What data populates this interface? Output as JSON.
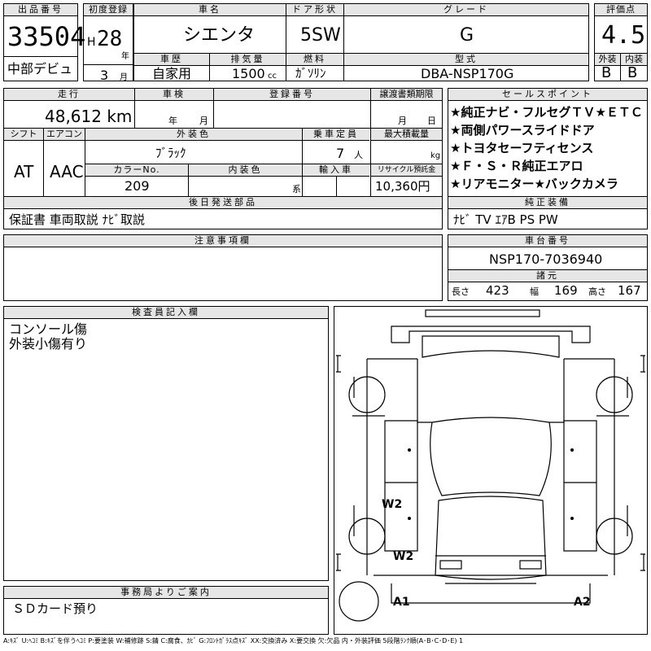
{
  "header": {
    "lot_label": "出品番号",
    "lot_no": "33504",
    "debut": "中部デビュ",
    "first_reg_label": "初度登録",
    "era": "H",
    "year": "28",
    "year_unit": "年",
    "month": "3",
    "month_unit": "月",
    "car_name_label": "車名",
    "car_name": "シエンタ",
    "door_label": "ドア形状",
    "door": "5SW",
    "grade_label": "グレード",
    "grade": "G",
    "score_label": "評価点",
    "score": "4.5",
    "history_label": "車歴",
    "history": "自家用",
    "displacement_label": "排気量",
    "displacement": "1500",
    "cc": "cc",
    "fuel_label": "燃料",
    "fuel": "ｶﾞｿﾘﾝ",
    "model_label": "型式",
    "model": "DBA-NSP170G",
    "ext_label": "外装",
    "ext_grade": "B",
    "int_label": "内装",
    "int_grade": "B"
  },
  "row2": {
    "mileage_label": "走行",
    "mileage": "48,612 km",
    "inspection_label": "車検",
    "insp_year": "年",
    "insp_month": "月",
    "reg_label": "登録番号",
    "transfer_label": "譲渡書類期限",
    "transfer_month": "月",
    "transfer_day": "日",
    "shift_label": "シフト",
    "shift": "AT",
    "ac_label": "エアコン",
    "ac": "AAC",
    "exterior_label": "外装色",
    "exterior": "ﾌﾞﾗｯｸ",
    "capacity_label": "乗車定員",
    "capacity": "7",
    "capacity_unit": "人",
    "load_label": "最大積載量",
    "load_unit": "kg",
    "color_no_label": "カラーNo.",
    "color_no": "209",
    "interior_label": "内装色",
    "interior_unit": "系",
    "import_label": "輸入車",
    "recycle_label": "リサイクル預託金",
    "recycle": "10,360円",
    "later_label": "後日発送部品",
    "later": "保証書 車両取説 ﾅﾋﾞ取説"
  },
  "selling": {
    "label": "セールスポイント",
    "items": [
      "★純正ナビ・フルセグＴＶ★ＥＴＣ",
      "★両側パワースライドドア",
      "★トヨタセーフティセンス",
      "★Ｆ・Ｓ・Ｒ純正エアロ",
      "★リアモニター★バックカメラ"
    ],
    "equip_label": "純正装備",
    "equip": "ﾅﾋﾞ TV ｴｱB PS PW"
  },
  "notes": {
    "label": "注意事項欄"
  },
  "chassis": {
    "label": "車台番号",
    "number": "NSP170-7036940",
    "spec_label": "諸元",
    "len_label": "長さ",
    "len": "423",
    "wid_label": "幅",
    "wid": "169",
    "hei_label": "高さ",
    "hei": "167"
  },
  "inspector": {
    "label": "検査員記入欄",
    "lines": [
      "コンソール傷",
      "外装小傷有り"
    ]
  },
  "office": {
    "label": "事務局よりご案内",
    "text": "ＳＤカード預り"
  },
  "diagram": {
    "marks": [
      "W2",
      "W2",
      "A1",
      "A2"
    ]
  },
  "legend": "A:ｷｽﾞ U:ﾍｺﾐ B:ｷｽﾞを伴うﾍｺﾐ P:要塗装 W:補修跡 S:錆 C:腐食、ｶﾋﾞ G:ﾌﾛﾝﾄｶﾞﾗｽ点ｷｽﾞ XX:交換済み X:要交換 欠:欠品 内・外装評価 5段階ﾗﾝｸ順(A･B･C･D･E) 1"
}
